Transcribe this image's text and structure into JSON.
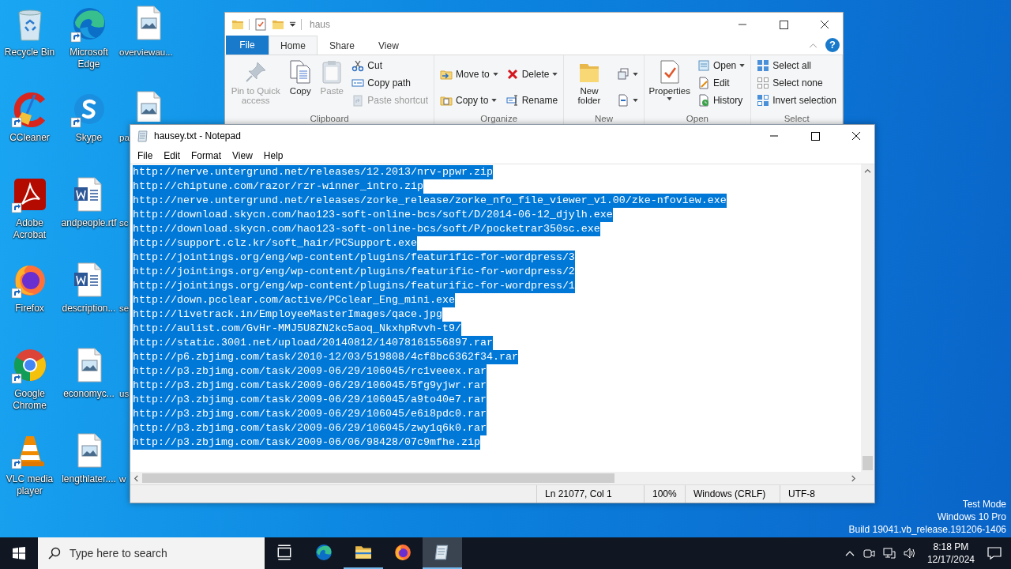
{
  "desktop_icons": [
    {
      "label": "Recycle Bin",
      "kind": "recycle-bin",
      "shortcut": false
    },
    {
      "label": "CCleaner",
      "kind": "ccleaner",
      "shortcut": true
    },
    {
      "label": "Adobe Acrobat",
      "kind": "acrobat",
      "shortcut": true
    },
    {
      "label": "Firefox",
      "kind": "firefox",
      "shortcut": true
    },
    {
      "label": "Google Chrome",
      "kind": "chrome",
      "shortcut": true
    },
    {
      "label": "VLC media player",
      "kind": "vlc",
      "shortcut": true
    },
    {
      "label": "Microsoft Edge",
      "kind": "edge",
      "shortcut": true
    },
    {
      "label": "Skype",
      "kind": "skype",
      "shortcut": true
    },
    {
      "label": "andpeople.rtf",
      "kind": "word-doc",
      "shortcut": false
    },
    {
      "label": "description...",
      "kind": "word-doc",
      "shortcut": false
    },
    {
      "label": "economyc...",
      "kind": "image-file",
      "shortcut": false
    },
    {
      "label": "lengthlater....",
      "kind": "image-file",
      "shortcut": false
    },
    {
      "label": "overviewau...",
      "kind": "image-file",
      "shortcut": false
    },
    {
      "label": "pa",
      "kind": "image-file",
      "shortcut": false
    },
    {
      "label": "sc"
    },
    {
      "label": "se"
    },
    {
      "label": "us"
    },
    {
      "label": "w"
    }
  ],
  "explorer": {
    "title": "haus",
    "file_tab": "File",
    "help_button": "?",
    "tabs": [
      {
        "label": "Home",
        "selected": true
      },
      {
        "label": "Share",
        "selected": false
      },
      {
        "label": "View",
        "selected": false
      }
    ],
    "ribbon_groups": [
      {
        "label": "Clipboard",
        "columns": [
          [
            {
              "label": "Pin to Quick access",
              "kind": "pin",
              "disabled": true,
              "dropdown": false
            }
          ],
          [
            {
              "label": "Copy",
              "kind": "copy",
              "disabled": false,
              "dropdown": false
            }
          ],
          [
            {
              "label": "Paste",
              "kind": "paste",
              "disabled": true,
              "dropdown": false
            }
          ],
          [
            {
              "label": "Cut",
              "kind": "cut",
              "disabled": false,
              "dropdown": false
            },
            {
              "label": "Copy path",
              "kind": "copy-path",
              "disabled": false,
              "dropdown": false
            },
            {
              "label": "Paste shortcut",
              "kind": "paste-shortcut",
              "disabled": true,
              "dropdown": false
            }
          ]
        ]
      },
      {
        "label": "Organize",
        "columns": [
          [
            {
              "label": "Move to",
              "kind": "move-to",
              "disabled": false,
              "dropdown": true
            },
            {
              "label": "Copy to",
              "kind": "copy-to",
              "disabled": false,
              "dropdown": true
            }
          ],
          [
            {
              "label": "Delete",
              "kind": "delete",
              "disabled": false,
              "dropdown": true
            },
            {
              "label": "Rename",
              "kind": "rename",
              "disabled": false,
              "dropdown": false
            }
          ]
        ]
      },
      {
        "label": "New",
        "columns": [
          [
            {
              "label": "New folder",
              "kind": "new-folder",
              "disabled": false,
              "dropdown": false
            }
          ],
          [
            {
              "kind": "new-item",
              "disabled": false,
              "dropdown": true
            },
            {
              "kind": "easy-access",
              "disabled": false,
              "dropdown": true
            }
          ]
        ]
      },
      {
        "label": "Open",
        "columns": [
          [
            {
              "label": "Properties",
              "kind": "properties",
              "disabled": false,
              "dropdown": true
            }
          ],
          [
            {
              "label": "Open",
              "kind": "open",
              "disabled": false,
              "dropdown": true
            },
            {
              "label": "Edit",
              "kind": "edit",
              "disabled": false,
              "dropdown": false
            },
            {
              "label": "History",
              "kind": "history",
              "disabled": false,
              "dropdown": false
            }
          ]
        ]
      },
      {
        "label": "Select",
        "columns": [
          [
            {
              "label": "Select all",
              "kind": "select-all",
              "disabled": false,
              "dropdown": false
            },
            {
              "label": "Select none",
              "kind": "select-none",
              "disabled": false,
              "dropdown": false
            },
            {
              "label": "Invert selection",
              "kind": "invert",
              "disabled": false,
              "dropdown": false
            }
          ]
        ]
      }
    ]
  },
  "notepad": {
    "title": "hausey.txt - Notepad",
    "menu": [
      "File",
      "Edit",
      "Format",
      "View",
      "Help"
    ],
    "lines": [
      {
        "text": "http://nerve.untergrund.net/releases/12.2013/nrv-ppwr.zip",
        "selected": true
      },
      {
        "text": "http://chiptune.com/razor/rzr-winner_intro.zip",
        "selected": true
      },
      {
        "text": "http://nerve.untergrund.net/releases/zorke_release/zorke_nfo_file_viewer_v1.00/zke-nfoview.exe",
        "selected": true
      },
      {
        "text": "http://download.skycn.com/hao123-soft-online-bcs/soft/D/2014-06-12_djylh.exe",
        "selected": true
      },
      {
        "text": "http://download.skycn.com/hao123-soft-online-bcs/soft/P/pocketrar350sc.exe",
        "selected": true
      },
      {
        "text": "http://support.clz.kr/soft_hair/PCSupport.exe",
        "selected": true
      },
      {
        "text": "http://jointings.org/eng/wp-content/plugins/featurific-for-wordpress/3",
        "selected": true
      },
      {
        "text": "http://jointings.org/eng/wp-content/plugins/featurific-for-wordpress/2",
        "selected": true
      },
      {
        "text": "http://jointings.org/eng/wp-content/plugins/featurific-for-wordpress/1",
        "selected": true
      },
      {
        "text": "http://down.pcclear.com/active/PCclear_Eng_mini.exe",
        "selected": true
      },
      {
        "text": "http://livetrack.in/EmployeeMasterImages/qace.jpg",
        "selected": true
      },
      {
        "text": "http://aulist.com/GvHr-MMJ5U8ZN2kc5aoq_NkxhpRvvh-t9/",
        "selected": true
      },
      {
        "text": "http://static.3001.net/upload/20140812/14078161556897.rar",
        "selected": true
      },
      {
        "text": "http://p6.zbjimg.com/task/2010-12/03/519808/4cf8bc6362f34.rar",
        "selected": true
      },
      {
        "text": "http://p3.zbjimg.com/task/2009-06/29/106045/rc1veeex.rar",
        "selected": true
      },
      {
        "text": "http://p3.zbjimg.com/task/2009-06/29/106045/5fg9yjwr.rar",
        "selected": true
      },
      {
        "text": "http://p3.zbjimg.com/task/2009-06/29/106045/a9to40e7.rar",
        "selected": true
      },
      {
        "text": "http://p3.zbjimg.com/task/2009-06/29/106045/e6i8pdc0.rar",
        "selected": true
      },
      {
        "text": "http://p3.zbjimg.com/task/2009-06/29/106045/zwy1q6k0.rar",
        "selected": true
      },
      {
        "text": "http://p3.zbjimg.com/task/2009-06/06/98428/07c9mfhe.zip",
        "selected": true
      }
    ],
    "status": [
      "Ln 21077, Col 1",
      "100%",
      "Windows (CRLF)",
      "UTF-8"
    ]
  },
  "system_info": [
    "Test Mode",
    "Windows 10 Pro",
    "Build 19041.vb_release.191206-1406"
  ],
  "taskbar": {
    "search_placeholder": "Type here to search",
    "apps": [
      {
        "kind": "task-view",
        "running": false,
        "active": false
      },
      {
        "kind": "edge",
        "running": false,
        "active": false
      },
      {
        "kind": "explorer",
        "running": true,
        "active": false
      },
      {
        "kind": "firefox",
        "running": false,
        "active": false
      },
      {
        "kind": "notepad",
        "running": true,
        "active": true
      }
    ],
    "time": "8:18 PM",
    "date": "12/17/2024"
  }
}
